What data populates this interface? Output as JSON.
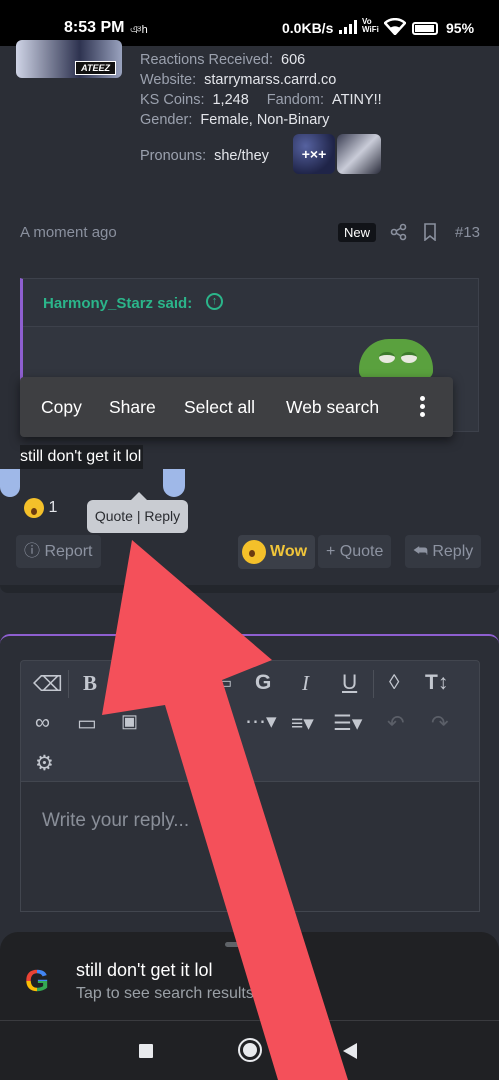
{
  "status_bar": {
    "time": "8:53 PM",
    "carrier_glyph": "ঞh",
    "net_speed": "0.0KB/s",
    "vowifi_top": "Vo",
    "vowifi_bottom": "WiFi",
    "battery": "95%"
  },
  "profile": {
    "avatar_tag": "ATEEZ",
    "reactions_label": "Reactions Received:",
    "reactions_value": "606",
    "website_label": "Website:",
    "website_value": "starrymarss.carrd.co",
    "coins_label": "KS Coins:",
    "coins_value": "1,248",
    "fandom_label": "Fandom:",
    "fandom_value": "ATINY!!",
    "gender_label": "Gender:",
    "gender_value": "Female, Non-Binary",
    "pronouns_label": "Pronouns:",
    "pronouns_value": "she/they",
    "badge_text": "+×+"
  },
  "post_meta": {
    "time_ago": "A moment ago",
    "new_badge": "New",
    "post_number": "#13"
  },
  "quote": {
    "author_said": "Harmony_Starz said:"
  },
  "context_menu": {
    "items": [
      "Copy",
      "Share",
      "Select all",
      "Web search"
    ]
  },
  "post": {
    "text": "still don't get it lol",
    "reaction_count": "1",
    "tooltip": "Quote | Reply"
  },
  "actions": {
    "report": "Report",
    "wow": "Wow",
    "quote": "+ Quote",
    "reply": "Reply"
  },
  "editor": {
    "placeholder": "Write your reply..."
  },
  "google_sheet": {
    "query": "still don't get it lol",
    "subtitle": "Tap to see search results"
  },
  "colors": {
    "accent_purple": "#8e5fd0",
    "quote_green": "#2bb58a",
    "arrow_red": "#f4505a",
    "background": "#2b2e36"
  }
}
